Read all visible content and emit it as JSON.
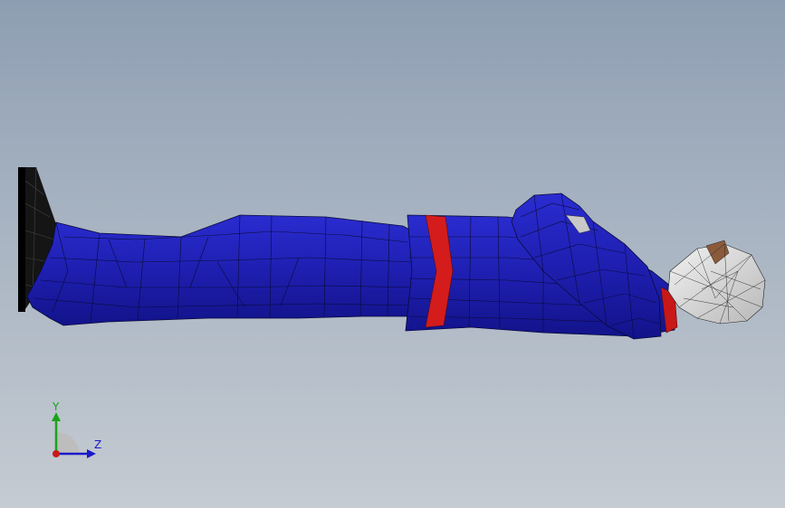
{
  "viewport": {
    "background_top": "#8e9eb2",
    "background_bottom": "#c5cbd2"
  },
  "model": {
    "icon": "lying-human-figure-mesh",
    "colors": {
      "suit": "#1e1fb0",
      "suit_shade": "#14158a",
      "belt": "#d41c1c",
      "shoe": "#1a1a1a",
      "head": "#e4e4e4",
      "hair": "#8a5a3a",
      "mesh_lines": "#0a0a3a"
    }
  },
  "triad": {
    "y_label": "Y",
    "z_label": "Z",
    "y_color": "#1aa31a",
    "z_color": "#1a1ac8",
    "x_color": "#c81a1a"
  }
}
